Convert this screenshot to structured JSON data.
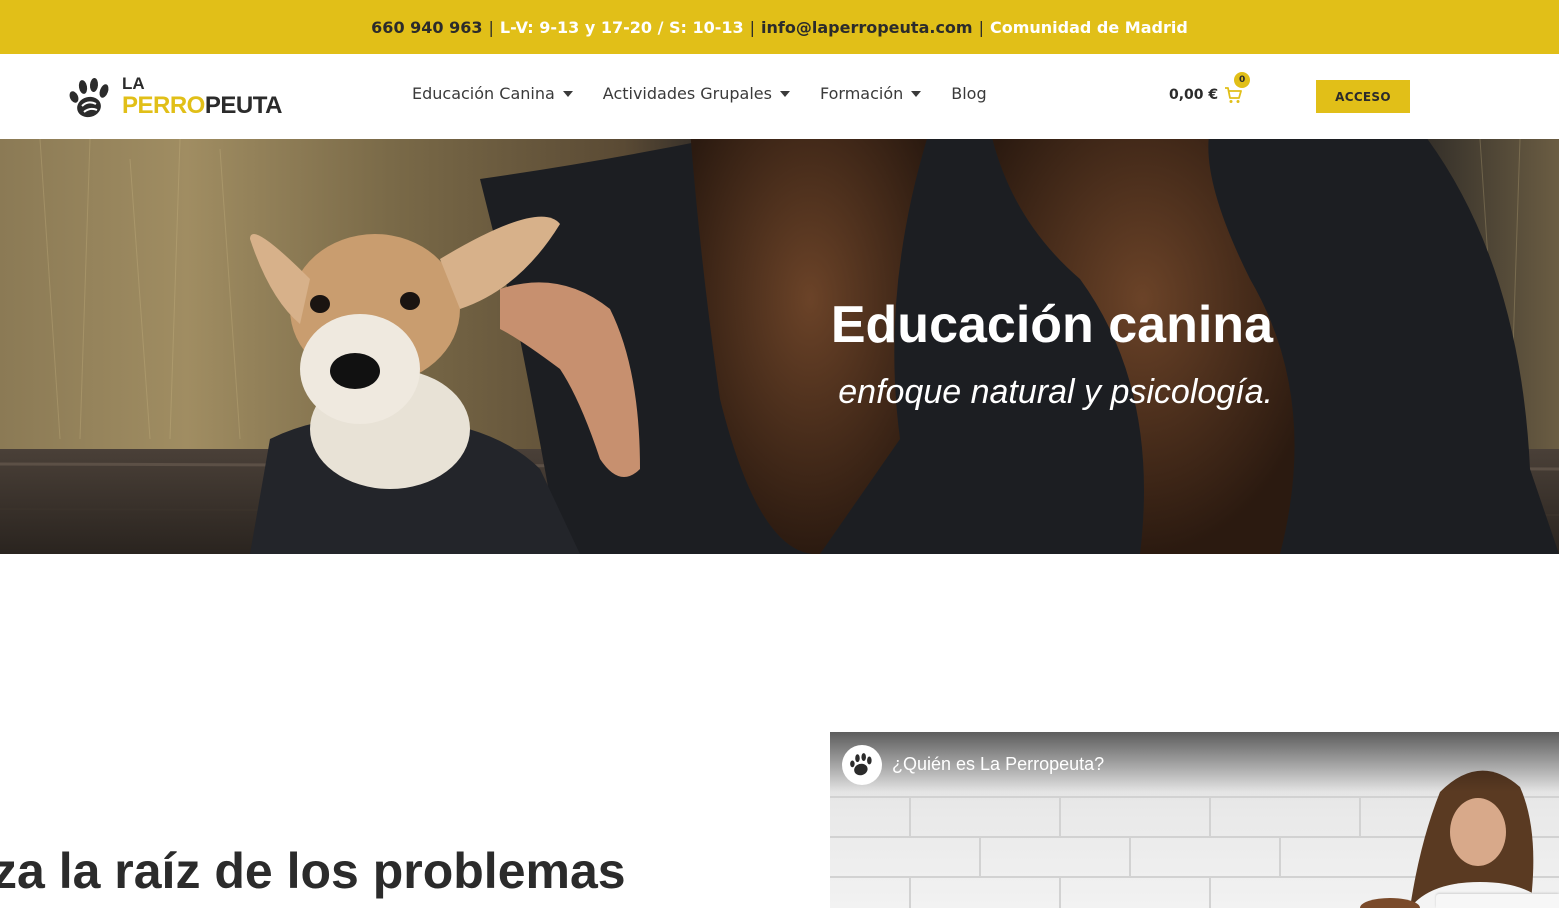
{
  "topbar": {
    "phone": "660 940 963",
    "hours": "L-V: 9-13 y 17-20 / S: 10-13",
    "email": "info@laperropeuta.com",
    "region": "Comunidad de Madrid",
    "separator": "|"
  },
  "logo": {
    "la": "LA",
    "perro": "PERRO",
    "peuta": "PEUTA",
    "icon": "paw-icon"
  },
  "nav": {
    "items": [
      {
        "label": "Educación Canina",
        "has_dropdown": true
      },
      {
        "label": "Actividades Grupales",
        "has_dropdown": true
      },
      {
        "label": "Formación",
        "has_dropdown": true
      },
      {
        "label": "Blog",
        "has_dropdown": false
      }
    ]
  },
  "cart": {
    "total": "0,00 €",
    "count": "0",
    "icon": "cart-icon"
  },
  "header": {
    "access_label": "ACCESO"
  },
  "hero": {
    "title": "Educación canina",
    "subtitle": "enfoque natural y psicología."
  },
  "section": {
    "heading": "za la raíz de los problemas"
  },
  "video": {
    "title": "¿Quién es La Perropeuta?",
    "channel_icon": "paw-icon"
  },
  "colors": {
    "accent": "#e1bf18",
    "dark": "#2b2b2b",
    "white": "#ffffff"
  }
}
